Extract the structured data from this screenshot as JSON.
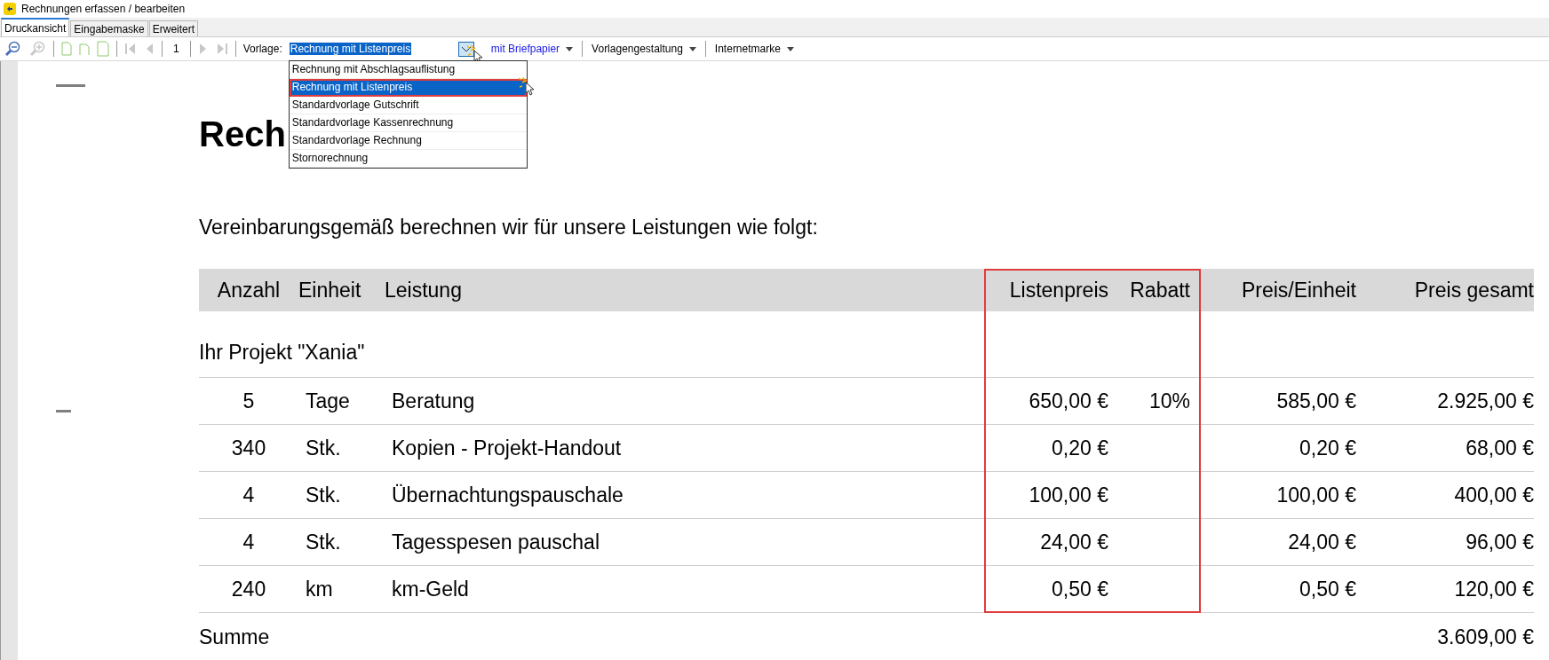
{
  "window": {
    "title": "Rechnungen erfassen / bearbeiten"
  },
  "tabs": [
    {
      "label": "Druckansicht",
      "selected": true
    },
    {
      "label": "Eingabemaske",
      "selected": false
    },
    {
      "label": "Erweitert",
      "selected": false
    }
  ],
  "toolbar": {
    "page": "1",
    "template_label": "Vorlage:",
    "template_value": "Rechnung mit Listenpreis",
    "menus": [
      {
        "label": "mit Briefpapier",
        "kind": "link"
      },
      {
        "label": "Vorlagengestaltung",
        "kind": "menu"
      },
      {
        "label": "Internetmarke",
        "kind": "menu"
      }
    ]
  },
  "template_dropdown": {
    "expanded": true,
    "options": [
      {
        "label": "Rechnung mit Abschlagsauflistung",
        "selected": false
      },
      {
        "label": "Rechnung mit Listenpreis",
        "selected": true
      },
      {
        "label": "Standardvorlage Gutschrift",
        "selected": false
      },
      {
        "label": "Standardvorlage Kassenrechnung",
        "selected": false
      },
      {
        "label": "Standardvorlage Rechnung",
        "selected": false
      },
      {
        "label": "Stornorechnung",
        "selected": false
      }
    ]
  },
  "document": {
    "heading": "Rech",
    "intro": "Vereinbarungsgemäß berechnen wir für unsere Leistungen wie folgt:",
    "table": {
      "columns": [
        {
          "label": "Anzahl",
          "highlighted": false
        },
        {
          "label": "Einheit",
          "highlighted": false
        },
        {
          "label": "Leistung",
          "highlighted": false
        },
        {
          "label": "Listenpreis",
          "highlighted": true
        },
        {
          "label": "Rabatt",
          "highlighted": true
        },
        {
          "label": "Preis/Einheit",
          "highlighted": false
        },
        {
          "label": "Preis gesamt",
          "highlighted": false
        }
      ],
      "group": "Ihr Projekt \"Xania\"",
      "rows": [
        {
          "cells": [
            "5",
            "Tage",
            "Beratung",
            "650,00 €",
            "10%",
            "585,00 €",
            "2.925,00 €"
          ]
        },
        {
          "cells": [
            "340",
            "Stk.",
            "Kopien - Projekt-Handout",
            "0,20 €",
            "",
            "0,20 €",
            "68,00 €"
          ]
        },
        {
          "cells": [
            "4",
            "Stk.",
            "Übernachtungspauschale",
            "100,00 €",
            "",
            "100,00 €",
            "400,00 €"
          ]
        },
        {
          "cells": [
            "4",
            "Stk.",
            "Tagesspesen pauschal",
            "24,00 €",
            "",
            "24,00 €",
            "96,00 €"
          ]
        },
        {
          "cells": [
            "240",
            "km",
            "km-Geld",
            "0,50 €",
            "",
            "0,50 €",
            "120,00 €"
          ]
        }
      ],
      "sum_label": "Summe",
      "sum_total": "3.609,00 €"
    }
  }
}
